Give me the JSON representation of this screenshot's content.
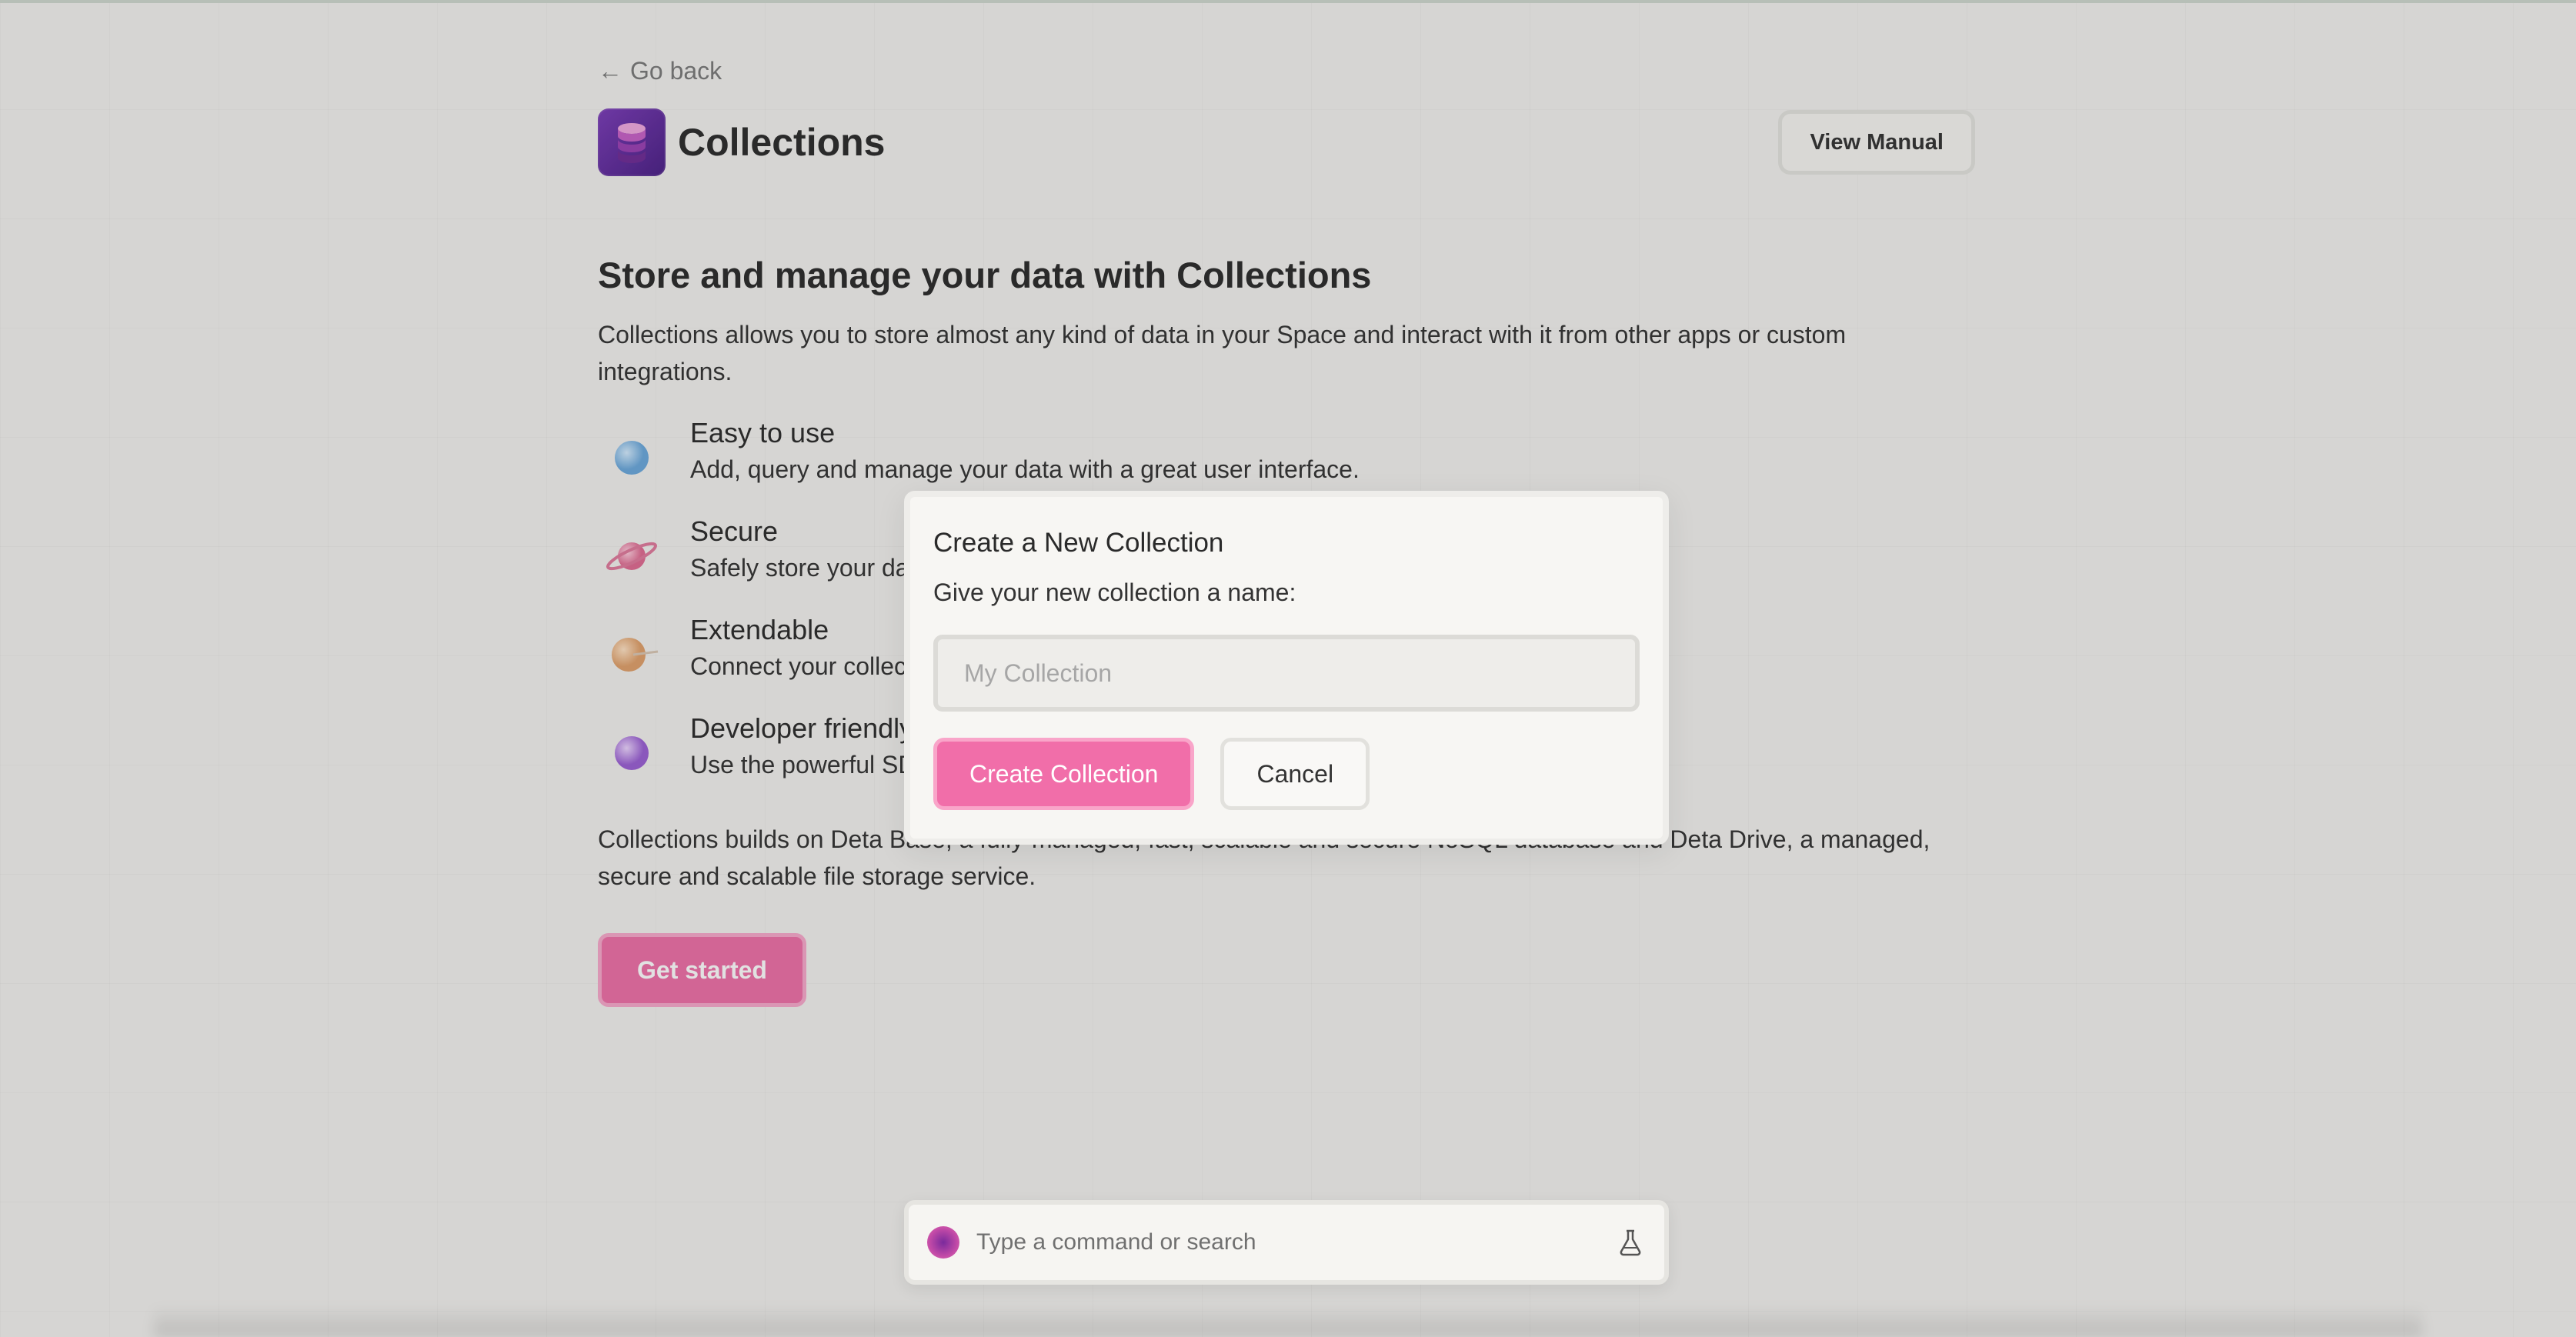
{
  "nav": {
    "back_arrow": "←",
    "back_label": "Go back"
  },
  "header": {
    "app_title": "Collections",
    "app_icon": "database-stack-icon",
    "view_manual_label": "View Manual"
  },
  "main": {
    "headline": "Store and manage your data with Collections",
    "intro": "Collections allows you to store almost any kind of data in your Space and interact with it from other apps or custom integrations.",
    "features": [
      {
        "icon": "blue-sphere-icon",
        "title": "Easy to use",
        "desc": "Add, query and manage your data with a great user interface."
      },
      {
        "icon": "pink-planet-icon",
        "title": "Secure",
        "desc": "Safely store your data in your own Space."
      },
      {
        "icon": "orange-planet-icon",
        "title": "Extendable",
        "desc": "Connect your collections with other apps and integrations in your Space."
      },
      {
        "icon": "purple-sphere-icon",
        "title": "Developer friendly",
        "desc": "Use the powerful SDKs and APIs to programmatically interact with your data."
      }
    ],
    "outro": "Collections builds on Deta Base, a fully-managed, fast, scalable and secure NoSQL database and Deta Drive, a managed, secure and scalable file storage service.",
    "get_started_label": "Get started"
  },
  "modal": {
    "title": "Create a New Collection",
    "subtitle": "Give your new collection a name:",
    "input_placeholder": "My Collection",
    "input_value": "",
    "create_label": "Create Collection",
    "cancel_label": "Cancel"
  },
  "command_bar": {
    "placeholder": "Type a command or search",
    "icon": "flask-icon"
  },
  "colors": {
    "accent": "#f16ea9",
    "background": "#f3f2ef",
    "app_icon": "#5b2a9a"
  }
}
